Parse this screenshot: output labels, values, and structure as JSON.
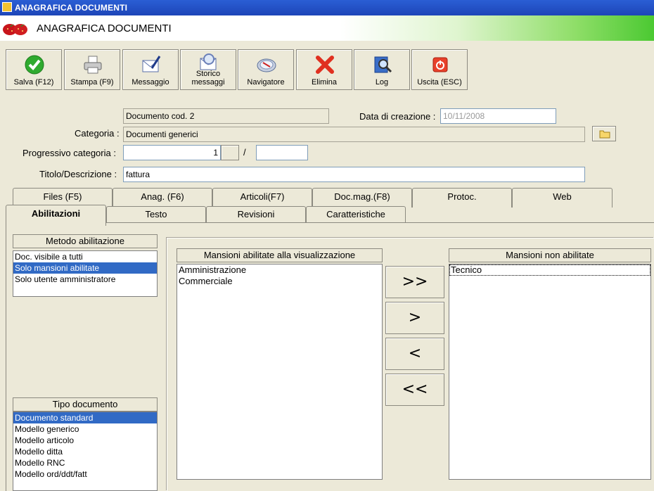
{
  "window": {
    "title": "ANAGRAFICA DOCUMENTI"
  },
  "header": {
    "title": "ANAGRAFICA DOCUMENTI"
  },
  "toolbar": {
    "buttons": [
      {
        "label": "Salva (F12)",
        "icon": "check-icon"
      },
      {
        "label": "Stampa (F9)",
        "icon": "printer-icon"
      },
      {
        "label": "Messaggio",
        "icon": "envelope-pen-icon"
      },
      {
        "label": "Storico\nmessaggi",
        "icon": "envelope-search-icon"
      },
      {
        "label": "Navigatore",
        "icon": "navigator-icon"
      },
      {
        "label": "Elimina",
        "icon": "delete-icon"
      },
      {
        "label": "Log",
        "icon": "log-icon"
      },
      {
        "label": "Uscita (ESC)",
        "icon": "exit-icon"
      }
    ]
  },
  "form": {
    "doc_code": "Documento cod. 2",
    "creation_label": "Data di creazione :",
    "creation_value": "10/11/2008",
    "category_label": "Categoria :",
    "category_value": "Documenti generici",
    "progressive_label": "Progressivo categoria :",
    "progressive_value": "1",
    "progressive_sep": "/",
    "progressive_suffix": "",
    "title_label": "Titolo/Descrizione :",
    "title_value": "fattura"
  },
  "tabs": {
    "row1": [
      "Files (F5)",
      "Anag. (F6)",
      "Articoli(F7)",
      "Doc.mag.(F8)",
      "Protoc.",
      "Web"
    ],
    "row2": [
      "Abilitazioni",
      "Testo",
      "Revisioni",
      "Caratteristiche"
    ],
    "active": "Abilitazioni"
  },
  "metodo": {
    "header": "Metodo abilitazione",
    "items": [
      "Doc. visibile a tutti",
      "Solo mansioni abilitate",
      "Solo utente amministratore"
    ],
    "selected": 1
  },
  "tipo": {
    "header": "Tipo documento",
    "items": [
      "Documento standard",
      "Modello generico",
      "Modello articolo",
      "Modello ditta",
      "Modello RNC",
      "Modello ord/ddt/fatt"
    ],
    "selected": 0
  },
  "abilitate": {
    "header": "Mansioni abilitate alla visualizzazione",
    "items": [
      "Amministrazione",
      "Commerciale"
    ]
  },
  "non_abilitate": {
    "header": "Mansioni non abilitate",
    "items": [
      "Tecnico"
    ]
  },
  "move_buttons": {
    "all_right": ">>",
    "right": ">",
    "left": "<",
    "all_left": "<<"
  }
}
